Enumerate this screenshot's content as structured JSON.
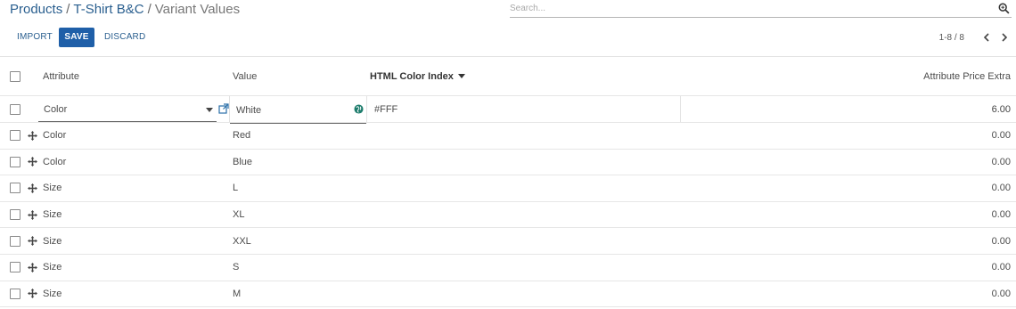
{
  "breadcrumb": {
    "items": [
      "Products",
      "T-Shirt B&C"
    ],
    "separator": "/",
    "current": "Variant Values"
  },
  "search": {
    "placeholder": "Search..."
  },
  "toolbar": {
    "import_label": "IMPORT",
    "save_label": "SAVE",
    "discard_label": "DISCARD"
  },
  "pager": {
    "value": "1-8 / 8"
  },
  "table": {
    "columns": {
      "attribute": "Attribute",
      "value": "Value",
      "html_color_index": "HTML Color Index",
      "price_extra": "Attribute Price Extra"
    },
    "edit_row": {
      "attribute": "Color",
      "value": "White",
      "html_color_index": "#FFF",
      "price_extra": "6.00"
    },
    "rows": [
      {
        "attribute": "Color",
        "value": "Red",
        "html_color_index": "",
        "price_extra": "0.00"
      },
      {
        "attribute": "Color",
        "value": "Blue",
        "html_color_index": "",
        "price_extra": "0.00"
      },
      {
        "attribute": "Size",
        "value": "L",
        "html_color_index": "",
        "price_extra": "0.00"
      },
      {
        "attribute": "Size",
        "value": "XL",
        "html_color_index": "",
        "price_extra": "0.00"
      },
      {
        "attribute": "Size",
        "value": "XXL",
        "html_color_index": "",
        "price_extra": "0.00"
      },
      {
        "attribute": "Size",
        "value": "S",
        "html_color_index": "",
        "price_extra": "0.00"
      },
      {
        "attribute": "Size",
        "value": "M",
        "html_color_index": "",
        "price_extra": "0.00"
      }
    ]
  },
  "colors": {
    "accent": "#1f5fa8",
    "link": "#2a5f8f",
    "globe": "#1e7d6d"
  }
}
